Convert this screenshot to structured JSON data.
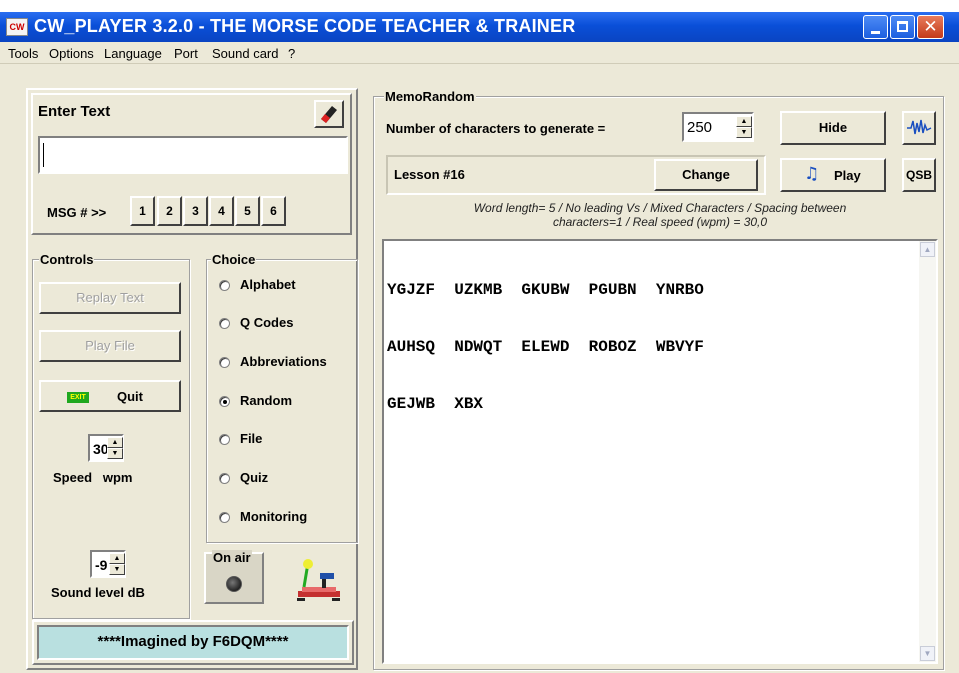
{
  "window": {
    "title": "CW_PLAYER 3.2.0 - THE  MORSE  CODE  TEACHER  &  TRAINER",
    "app_icon_text": "CW"
  },
  "menu": [
    "Tools",
    "Options",
    "Language",
    "Port",
    "Sound card",
    "?"
  ],
  "enter_text": {
    "label": "Enter Text",
    "value": "",
    "msg_label": "MSG # >>",
    "msg_buttons": [
      "1",
      "2",
      "3",
      "4",
      "5",
      "6"
    ]
  },
  "controls": {
    "group_label": "Controls",
    "replay_text": "Replay Text",
    "play_file": "Play File",
    "quit_icon_text": "EXIT",
    "quit": "Quit",
    "speed_value": "30",
    "speed_label": "Speed   wpm",
    "sound_value": "-9",
    "sound_label": "Sound level dB"
  },
  "choice": {
    "group_label": "Choice",
    "options": [
      {
        "label": "Alphabet",
        "checked": false
      },
      {
        "label": "Q Codes",
        "checked": false
      },
      {
        "label": "Abbreviations",
        "checked": false
      },
      {
        "label": "Random",
        "checked": true
      },
      {
        "label": "File",
        "checked": false
      },
      {
        "label": "Quiz",
        "checked": false
      },
      {
        "label": "Monitoring",
        "checked": false
      }
    ]
  },
  "on_air": {
    "label": "On air"
  },
  "credit": "****Imagined by F6DQM****",
  "memo": {
    "group_label": "MemoRandom",
    "num_chars_label": "Number of characters to generate =",
    "num_chars_value": "250",
    "hide": "Hide",
    "lesson": "Lesson #16",
    "change": "Change",
    "play": "Play",
    "qsb": "QSB",
    "info_line1": "Word length= 5 / No leading Vs / Mixed Characters / Spacing between",
    "info_line2": "characters=1 / Real speed (wpm) = 30,0",
    "text_lines": [
      "YGJZF  UZKMB  GKUBW  PGUBN  YNRBO",
      "AUHSQ  NDWQT  ELEWD  ROBOZ  WBVYF",
      "GEJWB  XBX"
    ]
  }
}
